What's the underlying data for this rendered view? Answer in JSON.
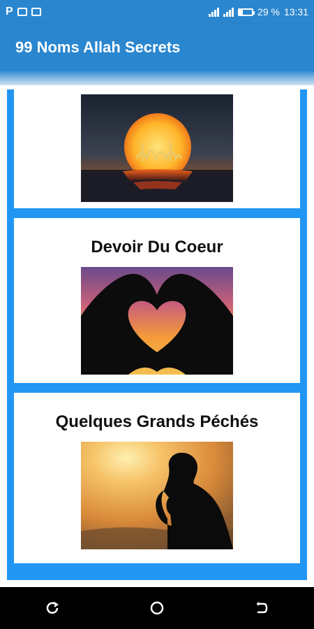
{
  "status_bar": {
    "left_letter": "P",
    "battery": "29 %",
    "battery_level": 0.29,
    "time": "13:31"
  },
  "app_bar": {
    "title": "99 Noms Allah Secrets"
  },
  "cards": [
    {
      "title": "",
      "image": "sunset-calligraphy-image"
    },
    {
      "title": "Devoir Du Coeur",
      "image": "heart-hands-silhouette-image"
    },
    {
      "title": "Quelques Grands Péchés",
      "image": "praying-silhouette-image"
    }
  ],
  "navigation": [
    "recent-apps",
    "home",
    "back"
  ],
  "colors": {
    "primary": "#2a86cf",
    "list_border": "#2196f3"
  }
}
